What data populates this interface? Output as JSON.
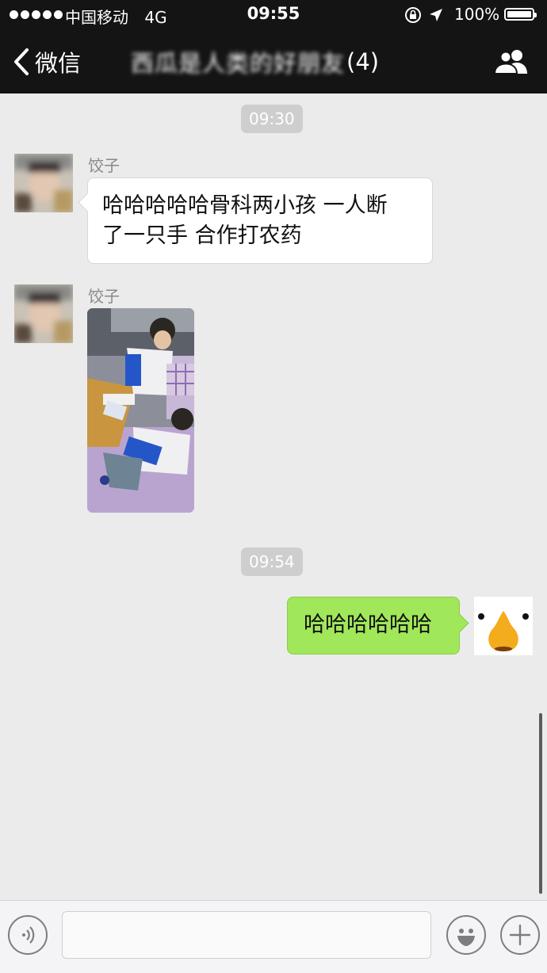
{
  "status_bar": {
    "carrier": "中国移动",
    "network": "4G",
    "time": "09:55",
    "battery": "100%"
  },
  "nav": {
    "back_label": "微信",
    "chat_title": "西瓜是人类的好朋友",
    "member_count": "(4)"
  },
  "messages": {
    "time1": "09:30",
    "msg1_sender": "饺子",
    "msg1_line1": "哈哈哈哈哈骨科两小孩 一人断",
    "msg1_line2": "了一只手 合作打农药",
    "msg2_sender": "饺子",
    "time2": "09:54",
    "msg3_text": "哈哈哈哈哈哈"
  },
  "input": {
    "placeholder": ""
  },
  "colors": {
    "bubble_out": "#a0e75a",
    "background": "#ebebeb",
    "topbar": "#141414"
  }
}
